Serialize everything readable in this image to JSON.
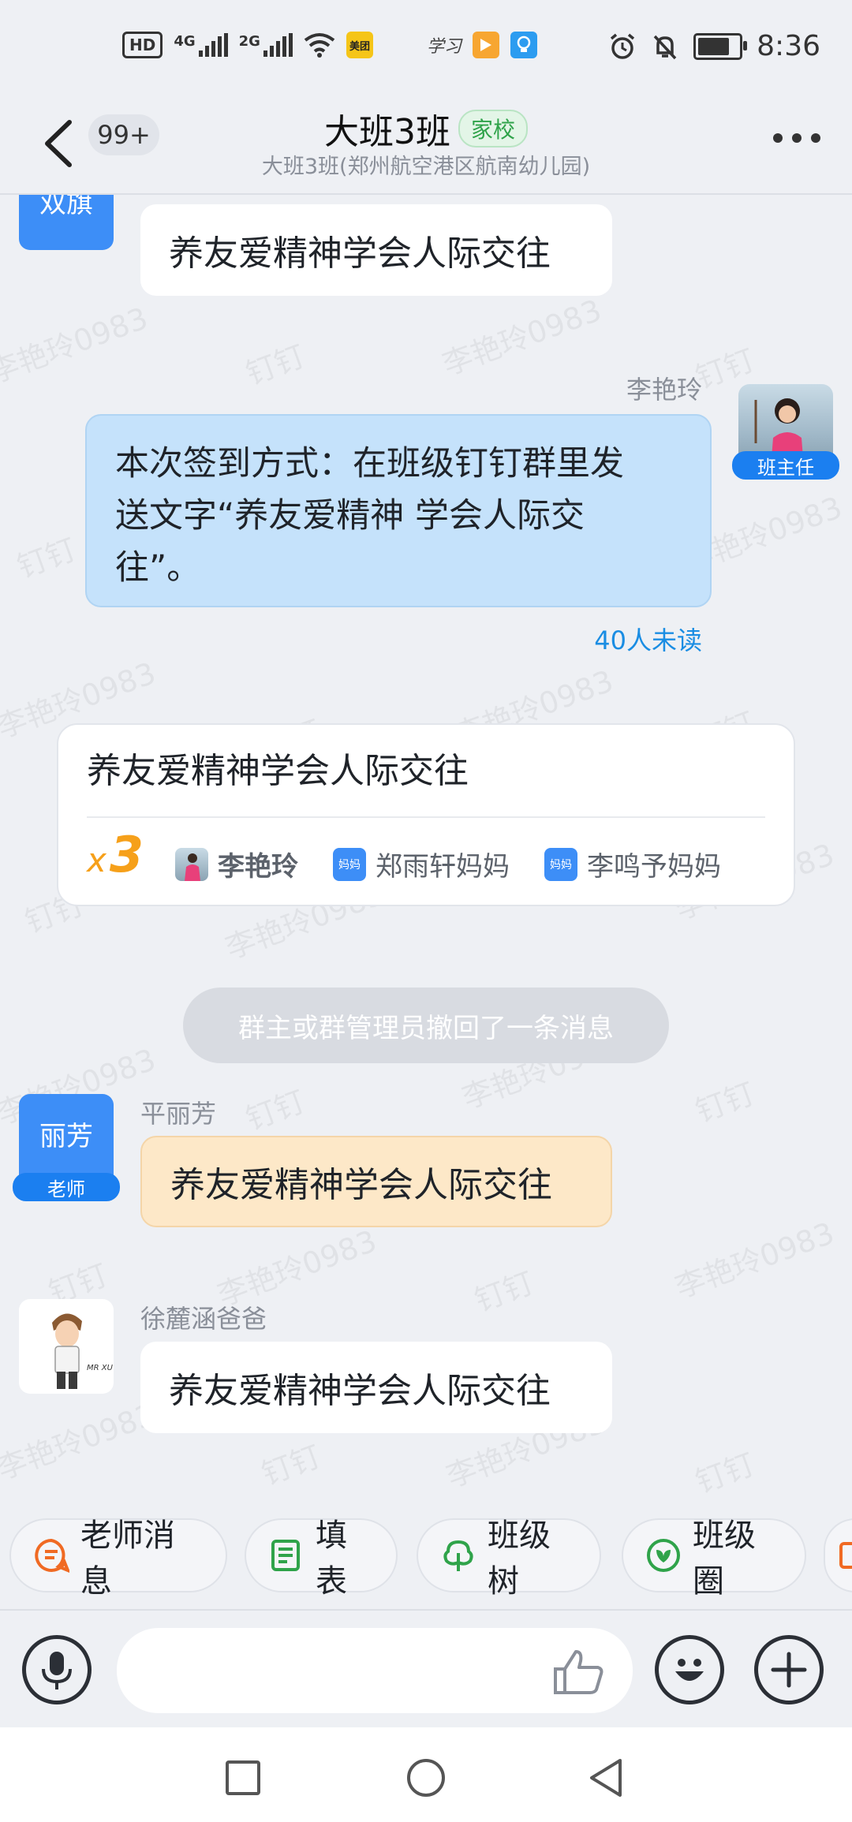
{
  "status_bar": {
    "hd_label": "HD",
    "net1": "4G",
    "net2": "2G",
    "meituan_label": "美团",
    "xuexi_label": "学习",
    "time": "8:36"
  },
  "header": {
    "back_badge": "99+",
    "title": "大班3班",
    "tag": "家校",
    "subtitle": "大班3班(郑州航空港区航南幼儿园)"
  },
  "watermarks": {
    "name_text": "李艳玲0983",
    "app_text": "钉钉"
  },
  "messages": {
    "m1": {
      "avatar_text": "双旗",
      "text": "养友爱精神学会人际交往"
    },
    "m2": {
      "sender": "李艳玲",
      "role": "班主任",
      "text_line1": "本次签到方式：在班级钉钉群里发",
      "text_line2": "送文字“养友爱精神 学会人际交",
      "text_line3": "往”。",
      "unread": "40人未读"
    },
    "repeat_card": {
      "text": "养友爱精神学会人际交往",
      "count_x": "x",
      "count_n": "3",
      "user1": "李艳玲",
      "user2_badge": "妈妈",
      "user2": "郑雨轩妈妈",
      "user3_badge": "妈妈",
      "user3": "李鸣予妈妈"
    },
    "system_notice": "群主或群管理员撤回了一条消息",
    "m3": {
      "avatar_text": "丽芳",
      "role": "老师",
      "sender": "平丽芳",
      "text": "养友爱精神学会人际交往"
    },
    "m4": {
      "sender": "徐麓涵爸爸",
      "avatar_text": "MR XU",
      "text": "养友爱精神学会人际交往"
    }
  },
  "quick_actions": [
    {
      "label": "老师消息",
      "icon": "teacher-message-icon",
      "color": "#f06a23"
    },
    {
      "label": "填表",
      "icon": "form-icon",
      "color": "#2fa34a"
    },
    {
      "label": "班级树",
      "icon": "tree-icon",
      "color": "#2fa34a"
    },
    {
      "label": "班级圈",
      "icon": "class-circle-icon",
      "color": "#2fa34a"
    }
  ],
  "colors": {
    "accent_blue": "#1b7ff0",
    "own_bubble": "#c5e2fb",
    "teacher_bubble": "#fde8c8",
    "unread_blue": "#1a8de3"
  }
}
